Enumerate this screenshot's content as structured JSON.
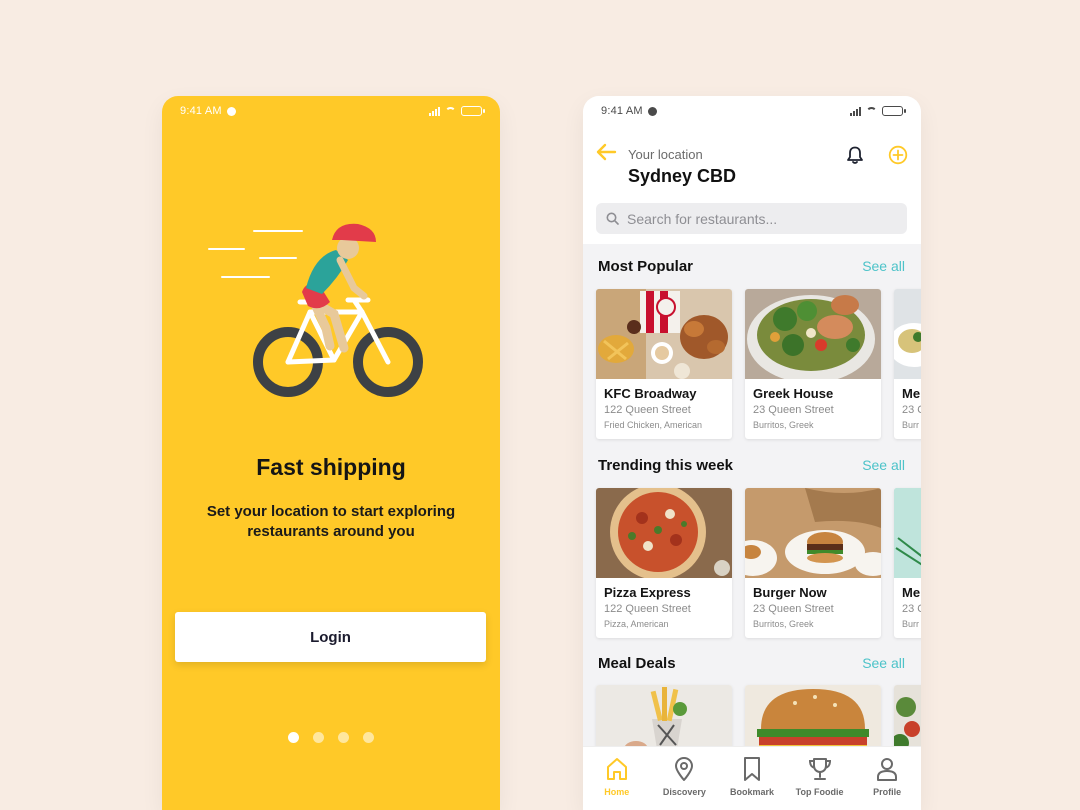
{
  "left": {
    "status": {
      "time": "9:41 AM"
    },
    "title": "Fast shipping",
    "subtitle": "Set your location to start exploring restaurants around you",
    "login_label": "Login",
    "page_count": 4,
    "active_page": 1
  },
  "right": {
    "status": {
      "time": "9:41 AM"
    },
    "location_label": "Your location",
    "location_city": "Sydney CBD",
    "search_placeholder": "Search for restaurants...",
    "sections": [
      {
        "title": "Most Popular",
        "see_all": "See all",
        "cards": [
          {
            "name": "KFC Broadway",
            "address": "122 Queen Street",
            "tags": "Fried Chicken, American",
            "image": "fried-chicken-food-photo"
          },
          {
            "name": "Greek House",
            "address": "23 Queen Street",
            "tags": "Burritos, Greek",
            "image": "salad-bowl-food-photo"
          },
          {
            "name": "Me",
            "address": "23 Q",
            "tags": "Burr",
            "image": "dish-food-photo"
          }
        ]
      },
      {
        "title": "Trending this week",
        "see_all": "See all",
        "cards": [
          {
            "name": "Pizza Express",
            "address": "122 Queen Street",
            "tags": "Pizza, American",
            "image": "pizza-food-photo"
          },
          {
            "name": "Burger Now",
            "address": "23 Queen Street",
            "tags": "Burritos, Greek",
            "image": "burger-plate-food-photo"
          },
          {
            "name": "Me",
            "address": "23 Q",
            "tags": "Burr",
            "image": "table-food-photo"
          }
        ]
      },
      {
        "title": "Meal Deals",
        "see_all": "See all",
        "cards": [
          {
            "image": "fries-cone-food-photo"
          },
          {
            "image": "burger-food-photo"
          },
          {
            "image": "greens-food-photo"
          }
        ]
      }
    ],
    "tabs": [
      {
        "label": "Home",
        "icon": "home-icon",
        "active": true
      },
      {
        "label": "Discovery",
        "icon": "map-pin-icon",
        "active": false
      },
      {
        "label": "Bookmark",
        "icon": "bookmark-icon",
        "active": false
      },
      {
        "label": "Top Foodie",
        "icon": "trophy-icon",
        "active": false
      },
      {
        "label": "Profile",
        "icon": "user-icon",
        "active": false
      }
    ]
  },
  "colors": {
    "background": "#f8ece3",
    "brand_yellow": "#ffc928",
    "accent_teal": "#4dc3c9"
  }
}
